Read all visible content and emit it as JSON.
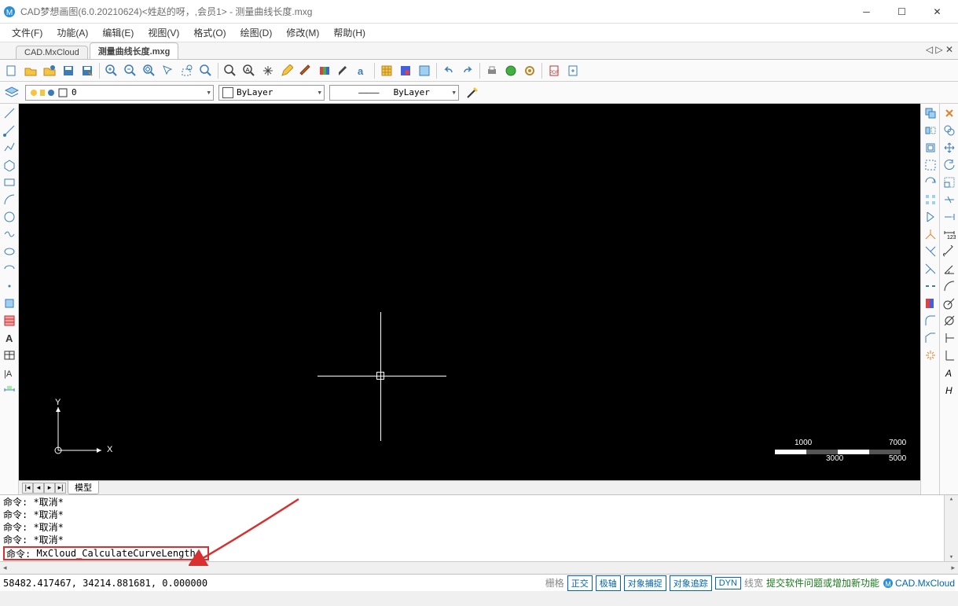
{
  "window": {
    "title": "CAD梦想画图(6.0.20210624)<姓赵的呀，,会员1> - 测量曲线长度.mxg"
  },
  "menu": {
    "file": "文件(F)",
    "function": "功能(A)",
    "edit": "编辑(E)",
    "view": "视图(V)",
    "format": "格式(O)",
    "draw": "绘图(D)",
    "modify": "修改(M)",
    "help": "帮助(H)"
  },
  "tabs": {
    "t1": "CAD.MxCloud",
    "t2": "测量曲线长度.mxg"
  },
  "props": {
    "layer": "0",
    "color": "ByLayer",
    "linetype": "ByLayer"
  },
  "model_tab": "模型",
  "ucs": {
    "x": "X",
    "y": "Y"
  },
  "scale": {
    "a": "1000",
    "b": "3000",
    "c": "5000",
    "d": "7000"
  },
  "cmd": {
    "h1": "命令:  *取消*",
    "h2": "命令:  *取消*",
    "h3": "命令:  *取消*",
    "h4": "命令:  *取消*",
    "prompt": "命令:",
    "input": "MxCloud_CalculateCurveLength"
  },
  "status": {
    "coords": "58482.417467,  34214.881681,  0.000000",
    "grid": "栅格",
    "ortho": "正交",
    "polar": "极轴",
    "osnap": "对象捕捉",
    "otrack": "对象追踪",
    "dyn": "DYN",
    "lwt": "线宽",
    "feedback": "提交软件问题或增加新功能",
    "brand": "CAD.MxCloud"
  }
}
